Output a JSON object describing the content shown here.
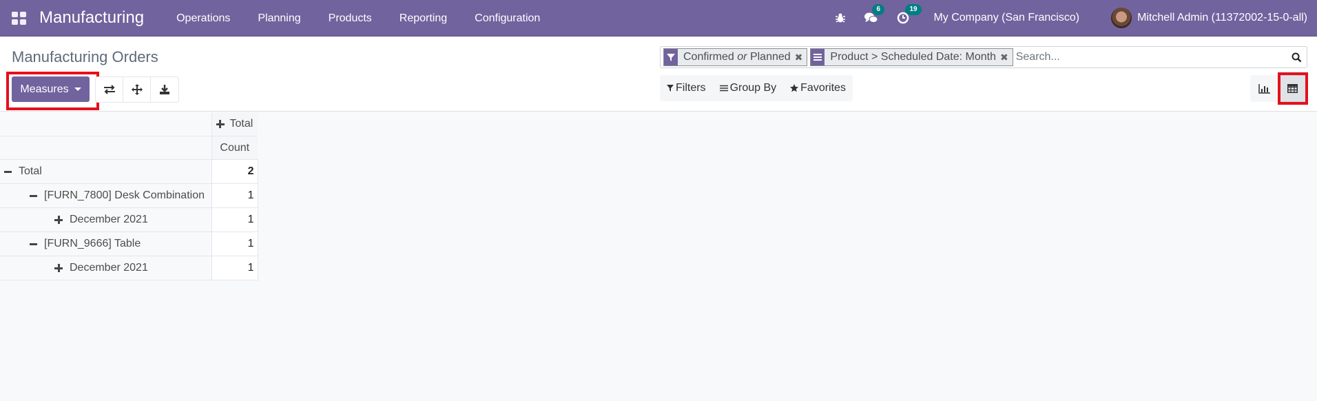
{
  "navbar": {
    "app_name": "Manufacturing",
    "menu": [
      "Operations",
      "Planning",
      "Products",
      "Reporting",
      "Configuration"
    ],
    "messages_count": "6",
    "activities_count": "19",
    "company": "My Company (San Francisco)",
    "user": "Mitchell Admin (11372002-15-0-all)"
  },
  "control_panel": {
    "title": "Manufacturing Orders",
    "measures_label": "Measures",
    "search": {
      "facets": [
        {
          "type": "filter",
          "label_a": "Confirmed",
          "label_or": "or",
          "label_b": "Planned"
        },
        {
          "type": "groupby",
          "label": "Product > Scheduled Date: Month"
        }
      ],
      "placeholder": "Search..."
    },
    "filters_label": "Filters",
    "groupby_label": "Group By",
    "favorites_label": "Favorites",
    "views": [
      {
        "name": "graph",
        "active": false
      },
      {
        "name": "pivot",
        "active": true
      }
    ]
  },
  "pivot": {
    "col_header": "Total",
    "measure": "Count",
    "rows": [
      {
        "label": "Total",
        "level": 0,
        "expanded": true,
        "value": "2"
      },
      {
        "label": "[FURN_7800] Desk Combination",
        "level": 1,
        "expanded": true,
        "value": "1"
      },
      {
        "label": "December 2021",
        "level": 2,
        "expanded": false,
        "value": "1"
      },
      {
        "label": "[FURN_9666] Table",
        "level": 1,
        "expanded": true,
        "value": "1"
      },
      {
        "label": "December 2021",
        "level": 2,
        "expanded": false,
        "value": "1"
      }
    ]
  }
}
